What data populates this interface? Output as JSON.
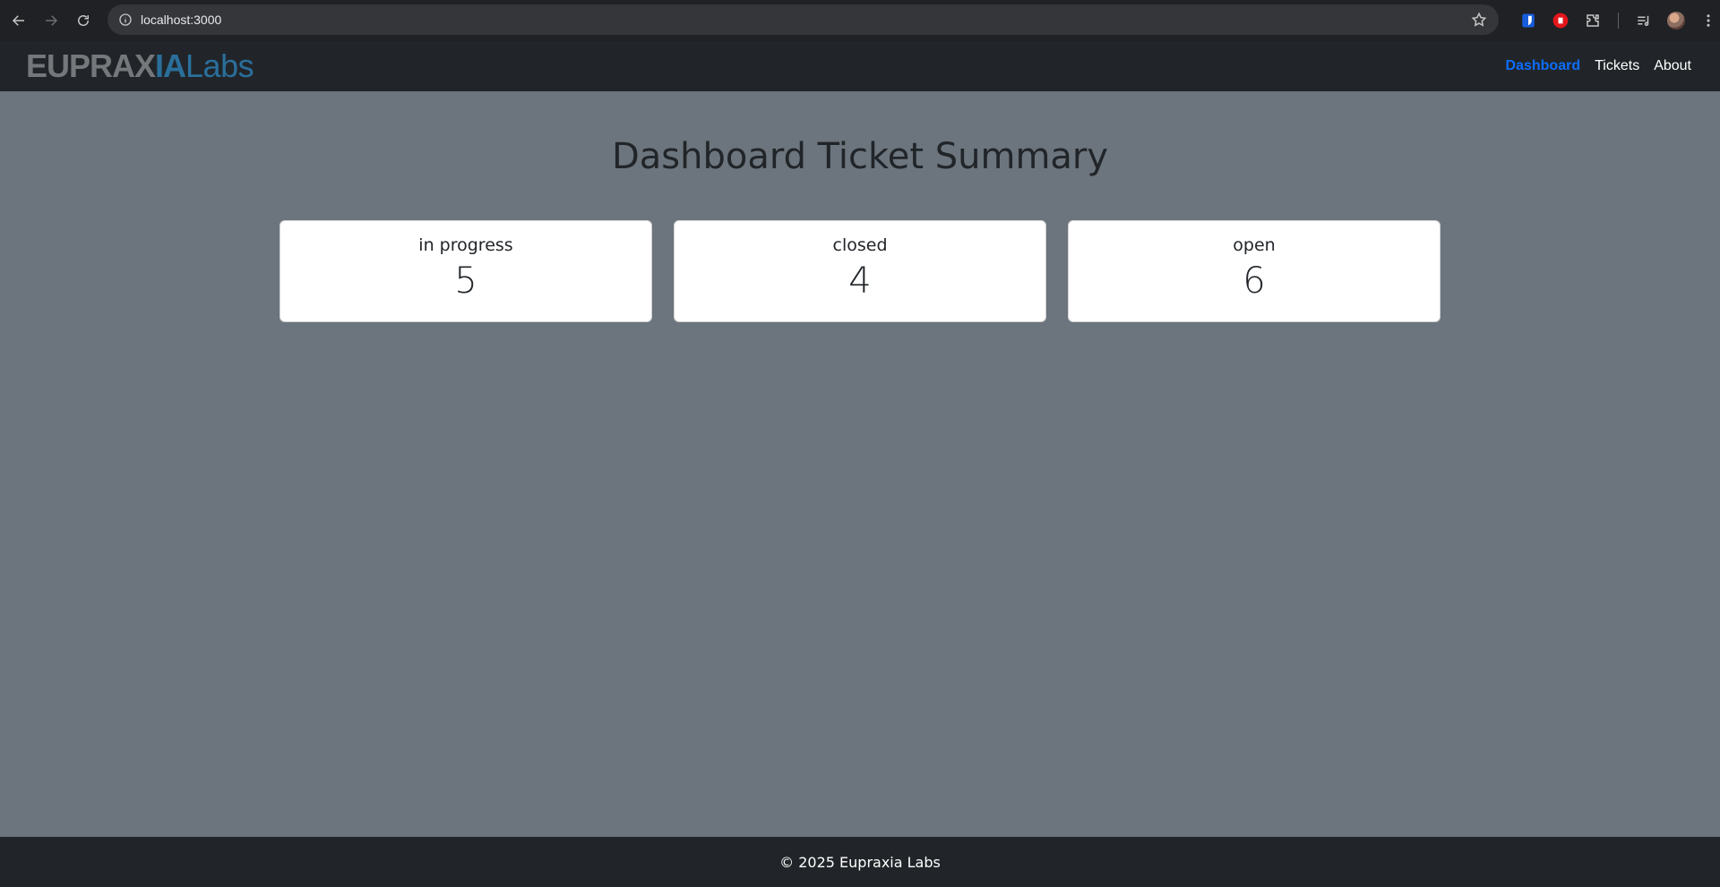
{
  "browser": {
    "url": "localhost:3000",
    "icons": [
      "back-arrow-icon",
      "forward-arrow-icon",
      "reload-icon",
      "site-info-icon",
      "bookmark-star-icon",
      "bitwarden-extension-icon",
      "adblock-extension-icon",
      "extensions-puzzle-icon",
      "media-playlist-icon",
      "profile-avatar",
      "kebab-menu-icon"
    ]
  },
  "navbar": {
    "brand_main": "EUPRAX",
    "brand_accent": "IA",
    "brand_labs": "Labs",
    "links": [
      {
        "label": "Dashboard",
        "active": true
      },
      {
        "label": "Tickets",
        "active": false
      },
      {
        "label": "About",
        "active": false
      }
    ],
    "active_color": "#0d6efd"
  },
  "main": {
    "title": "Dashboard Ticket Summary",
    "cards": [
      {
        "label": "in progress",
        "count": "5"
      },
      {
        "label": "closed",
        "count": "4"
      },
      {
        "label": "open",
        "count": "6"
      }
    ]
  },
  "footer": {
    "text": "© 2025 Eupraxia Labs"
  },
  "colors": {
    "page_background": "#6c757d",
    "navbar_background": "#212529",
    "card_background": "#ffffff"
  }
}
